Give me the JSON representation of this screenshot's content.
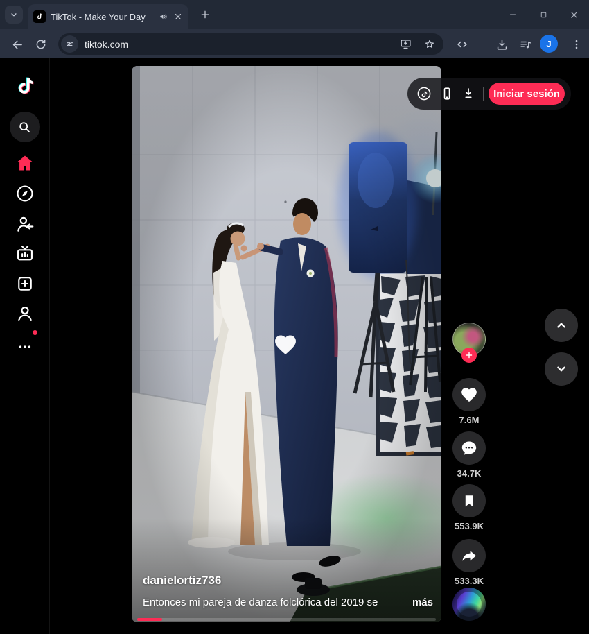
{
  "browser": {
    "tab_title": "TikTok - Make Your Day",
    "url": "tiktok.com",
    "profile_initial": "J"
  },
  "video_overlay": {
    "login_button": "Iniciar sesión"
  },
  "post": {
    "username": "danielortiz736",
    "caption": "Entonces mi pareja de danza folclórica del 2019 se",
    "more_label": "más",
    "likes": "7.6M",
    "comments": "34.7K",
    "favorites": "553.9K",
    "shares": "533.3K"
  },
  "colors": {
    "accent": "#fe2c55",
    "browser_avatar": "#1a73e8"
  }
}
